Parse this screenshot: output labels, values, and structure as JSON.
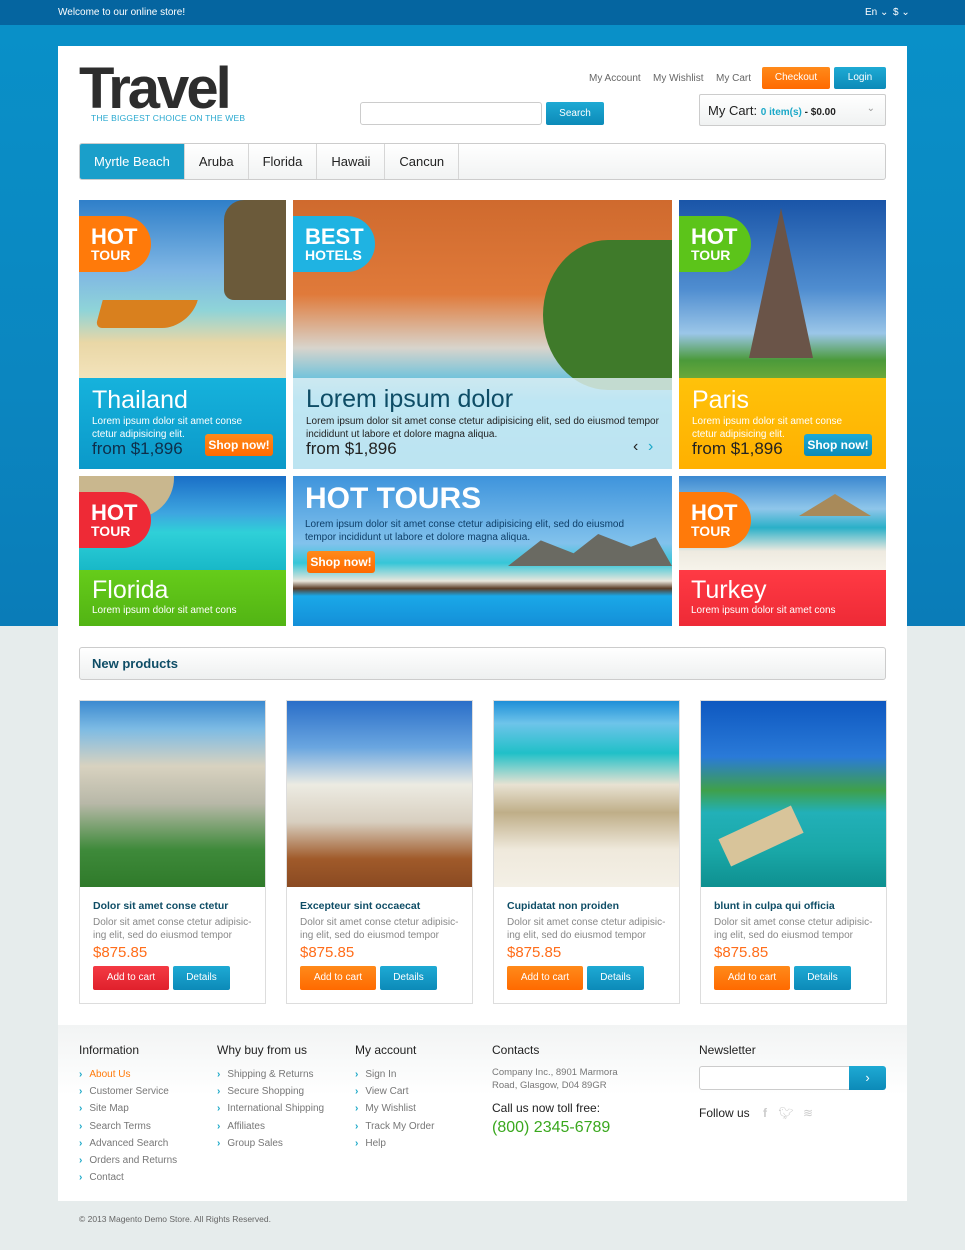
{
  "topbar": {
    "welcome": "Welcome to our online store!",
    "language": "En",
    "currency": "$"
  },
  "header": {
    "logo": "Travel",
    "tagline": "THE BIGGEST CHOICE ON THE WEB",
    "links": [
      "My Account",
      "My Wishlist",
      "My Cart"
    ],
    "checkout": "Checkout",
    "login": "Login",
    "search_button": "Search",
    "search_placeholder": "",
    "cart": {
      "label": "My Cart:",
      "items": "0 item(s)",
      "separator": " - ",
      "total": "$0.00"
    }
  },
  "nav": {
    "tabs": [
      "Myrtle Beach",
      "Aruba",
      "Florida",
      "Hawaii",
      "Cancun"
    ],
    "active": 0
  },
  "tiles": {
    "thailand": {
      "badge1": "HOT",
      "badge2": "TOUR",
      "title": "Thailand",
      "desc": "Lorem ipsum dolor sit amet conse ctetur adipisicing elit.",
      "price": "from $1,896",
      "button": "Shop now!"
    },
    "hotels": {
      "badge1": "BEST",
      "badge2": "HOTELS",
      "title": "Lorem ipsum dolor",
      "desc": "Lorem ipsum dolor sit amet conse ctetur adipisicing elit, sed do eiusmod tempor incididunt ut labore et dolore magna aliqua.",
      "price": "from $1,896"
    },
    "paris": {
      "badge1": "HOT",
      "badge2": "TOUR",
      "title": "Paris",
      "desc": "Lorem ipsum dolor sit amet conse ctetur adipisicing elit.",
      "price": "from $1,896",
      "button": "Shop now!"
    },
    "florida": {
      "badge1": "HOT",
      "badge2": "TOUR",
      "title": "Florida",
      "desc": "Lorem ipsum dolor sit amet cons"
    },
    "hottours": {
      "title": "HOT TOURS",
      "desc": "Lorem ipsum dolor sit amet conse ctetur adipisicing elit, sed do eiusmod tempor incididunt ut labore et dolore magna aliqua.",
      "button": "Shop now!"
    },
    "turkey": {
      "badge1": "HOT",
      "badge2": "TOUR",
      "title": "Turkey",
      "desc": "Lorem ipsum dolor sit amet cons"
    }
  },
  "new_products": {
    "heading": "New products",
    "items": [
      {
        "name": "Dolor sit amet conse ctetur",
        "desc": "Dolor sit amet conse ctetur adipisic-ing elit, sed do eiusmod tempor",
        "price": "$875.85",
        "add": "Add to cart",
        "details": "Details",
        "add_color": "#ee2a36"
      },
      {
        "name": "Excepteur sint occaecat",
        "desc": "Dolor sit amet conse ctetur adipisic-ing elit, sed do eiusmod tempor",
        "price": "$875.85",
        "add": "Add to cart",
        "details": "Details",
        "add_color": "#ff7a0a"
      },
      {
        "name": "Cupidatat non proiden",
        "desc": "Dolor sit amet conse ctetur adipisic-ing elit, sed do eiusmod tempor",
        "price": "$875.85",
        "add": "Add to cart",
        "details": "Details",
        "add_color": "#ff7a0a"
      },
      {
        "name": "blunt in culpa qui officia",
        "desc": "Dolor sit amet conse ctetur adipisic-ing elit, sed do eiusmod tempor",
        "price": "$875.85",
        "add": "Add to cart",
        "details": "Details",
        "add_color": "#ff7a0a"
      }
    ]
  },
  "footer": {
    "information": {
      "title": "Information",
      "items": [
        "About Us",
        "Customer Service",
        "Site Map",
        "Search Terms",
        "Advanced Search",
        "Orders and Returns",
        "Contact"
      ]
    },
    "why": {
      "title": "Why buy from us",
      "items": [
        "Shipping & Returns",
        "Secure Shopping",
        "International Shipping",
        "Affiliates",
        "Group Sales"
      ]
    },
    "account": {
      "title": "My account",
      "items": [
        "Sign In",
        "View Cart",
        "My Wishlist",
        "Track My Order",
        "Help"
      ]
    },
    "contacts": {
      "title": "Contacts",
      "address1": "Company Inc., 8901 Marmora",
      "address2": "Road, Glasgow, D04 89GR",
      "call": "Call us now toll free:",
      "phone": "(800) 2345-6789"
    },
    "newsletter": {
      "title": "Newsletter",
      "placeholder": "",
      "follow": "Follow us"
    },
    "copyright": "© 2013 Magento Demo Store. All Rights Reserved."
  },
  "colors": {
    "primary": "#1a9fca",
    "orange": "#ff7a0a",
    "red": "#ee2a36",
    "green": "#5cc41a",
    "yellow": "#ffbe0a",
    "price": "#ff6d1a",
    "phone": "#3aa81e"
  }
}
